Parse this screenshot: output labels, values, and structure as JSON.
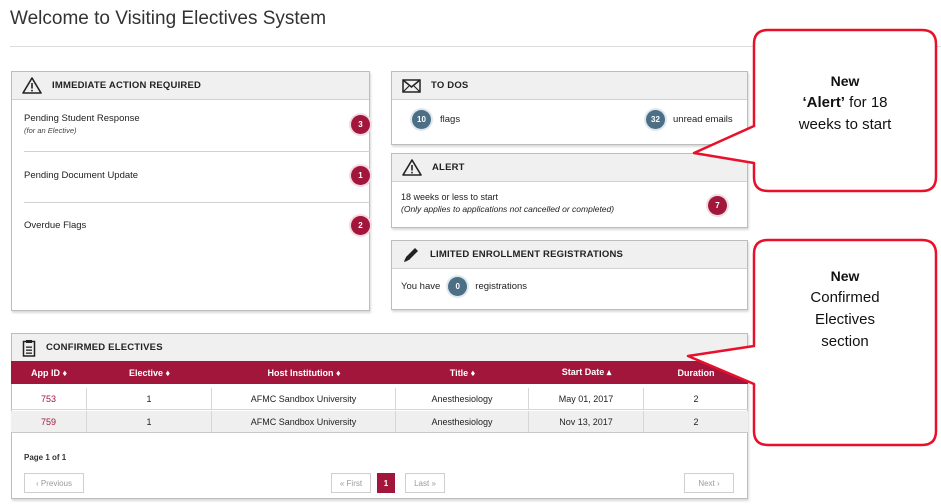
{
  "page": {
    "title": "Welcome to Visiting Electives System"
  },
  "immediate_action": {
    "heading": "IMMEDIATE ACTION REQUIRED",
    "items": [
      {
        "label": "Pending Student Response",
        "sub": "(for an Elective)",
        "count": "3"
      },
      {
        "label": "Pending Document Update",
        "sub": "",
        "count": "1"
      },
      {
        "label": "Overdue Flags",
        "sub": "",
        "count": "2"
      }
    ]
  },
  "todos": {
    "heading": "TO DOS",
    "flags_count": "10",
    "flags_label": "flags",
    "emails_count": "32",
    "emails_label": "unread emails"
  },
  "alert": {
    "heading": "ALERT",
    "line1": "18 weeks or less to start",
    "line2": "(Only applies to applications not cancelled or completed)",
    "count": "7"
  },
  "limited": {
    "heading": "LIMITED ENROLLMENT REGISTRATIONS",
    "prefix": "You have",
    "count": "0",
    "suffix": "registrations"
  },
  "confirmed": {
    "heading": "CONFIRMED ELECTIVES",
    "columns": [
      "App ID ♦",
      "Elective ♦",
      "Host Institution ♦",
      "Title ♦",
      "Start Date ▴",
      "Duration"
    ],
    "rows": [
      [
        "753",
        "1",
        "AFMC Sandbox University",
        "Anesthesiology",
        "May 01, 2017",
        "2"
      ],
      [
        "759",
        "1",
        "AFMC Sandbox University",
        "Anesthesiology",
        "Nov 13, 2017",
        "2"
      ]
    ],
    "page_info": "Page 1 of 1",
    "previous": "‹ Previous",
    "first": "« First",
    "current_page": "1",
    "last": "Last »",
    "next": "Next ›"
  },
  "callouts": {
    "alert_new": "New",
    "alert_text": "‘Alert’",
    "alert_rest": " for 18",
    "alert_line3": "weeks to start",
    "confirmed_new": "New",
    "confirmed_line2": "Confirmed",
    "confirmed_line3": "Electives",
    "confirmed_line4": "section"
  },
  "colors": {
    "accent": "#a3163c",
    "badge_blue": "#4d6f86",
    "callout_border": "#e8102a"
  }
}
